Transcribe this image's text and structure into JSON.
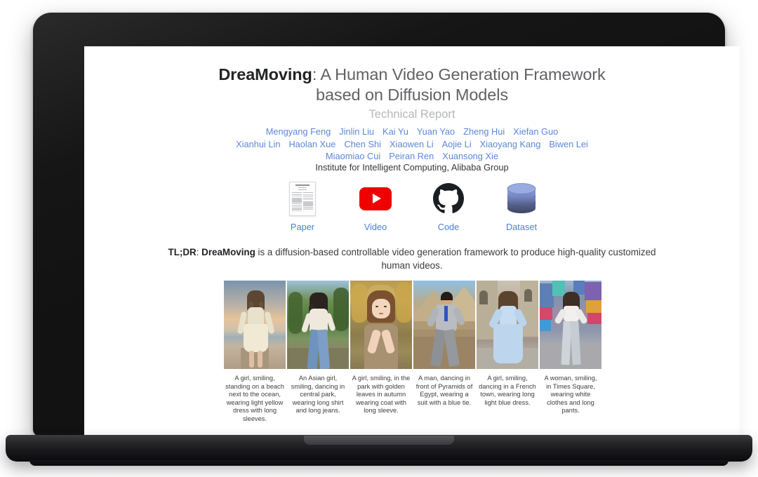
{
  "page": {
    "title_bold": "DreaMoving",
    "title_rest": ": A Human Video Generation Framework based on Diffusion Models",
    "title_line1_rest": ": A Human Video Generation Framework",
    "title_line2": "based on Diffusion Models",
    "subtitle": "Technical Report",
    "affiliation": "Institute for Intelligent Computing, Alibaba Group"
  },
  "authors": [
    {
      "name": "Mengyang Feng",
      "row": 0
    },
    {
      "name": "Jinlin Liu",
      "row": 0
    },
    {
      "name": "Kai Yu",
      "row": 0
    },
    {
      "name": "Yuan Yao",
      "row": 0
    },
    {
      "name": "Zheng Hui",
      "row": 0
    },
    {
      "name": "Xiefan Guo",
      "row": 0
    },
    {
      "name": "Xianhui Lin",
      "row": 1
    },
    {
      "name": "Haolan Xue",
      "row": 1
    },
    {
      "name": "Chen Shi",
      "row": 1
    },
    {
      "name": "Xiaowen Li",
      "row": 1
    },
    {
      "name": "Aojie Li",
      "row": 1
    },
    {
      "name": "Xiaoyang Kang",
      "row": 1
    },
    {
      "name": "Biwen Lei",
      "row": 1
    },
    {
      "name": "Miaomiao Cui",
      "row": 2
    },
    {
      "name": "Peiran Ren",
      "row": 2
    },
    {
      "name": "Xuansong Xie",
      "row": 2
    }
  ],
  "links": [
    {
      "label": "Paper",
      "icon": "paper-document-icon"
    },
    {
      "label": "Video",
      "icon": "youtube-play-icon"
    },
    {
      "label": "Code",
      "icon": "github-octocat-icon"
    },
    {
      "label": "Dataset",
      "icon": "database-cylinder-icon"
    }
  ],
  "tldr": {
    "prefix": "TL;DR",
    "separator": ": ",
    "project": "DreaMoving",
    "body": " is a diffusion-based controllable video generation framework to produce high-quality customized human videos."
  },
  "gallery": [
    {
      "caption": "A girl, smiling, standing on a beach next to the ocean, wearing light yellow dress with long sleeves.",
      "scene": "beach-sunset"
    },
    {
      "caption": "An Asian girl, smiling, dancing in central park, wearing long shirt and long jeans.",
      "scene": "green-park"
    },
    {
      "caption": "A girl, smiling, in the park with golden leaves in autumn wearing coat with long sleeve.",
      "scene": "autumn-park"
    },
    {
      "caption": "A man, dancing in front of Pyramids of Egypt, wearing a suit with a blue tie.",
      "scene": "pyramids-egypt"
    },
    {
      "caption": "A girl, smiling, dancing in a French town, wearing long light blue dress.",
      "scene": "french-town"
    },
    {
      "caption": "A woman, smiling, in Times Square, wearing white clothes and long pants.",
      "scene": "times-square"
    }
  ],
  "colors": {
    "link_blue": "#4a7fd4",
    "author_blue": "#5b87d8",
    "title_gray": "#5f6063",
    "title_dark": "#1d1e20",
    "subtitle_gray": "#b4b6b9",
    "youtube_red": "#f00000",
    "github_black": "#1b1f23",
    "database_top": "#8c9fdb",
    "taskbar": "#191b33"
  }
}
